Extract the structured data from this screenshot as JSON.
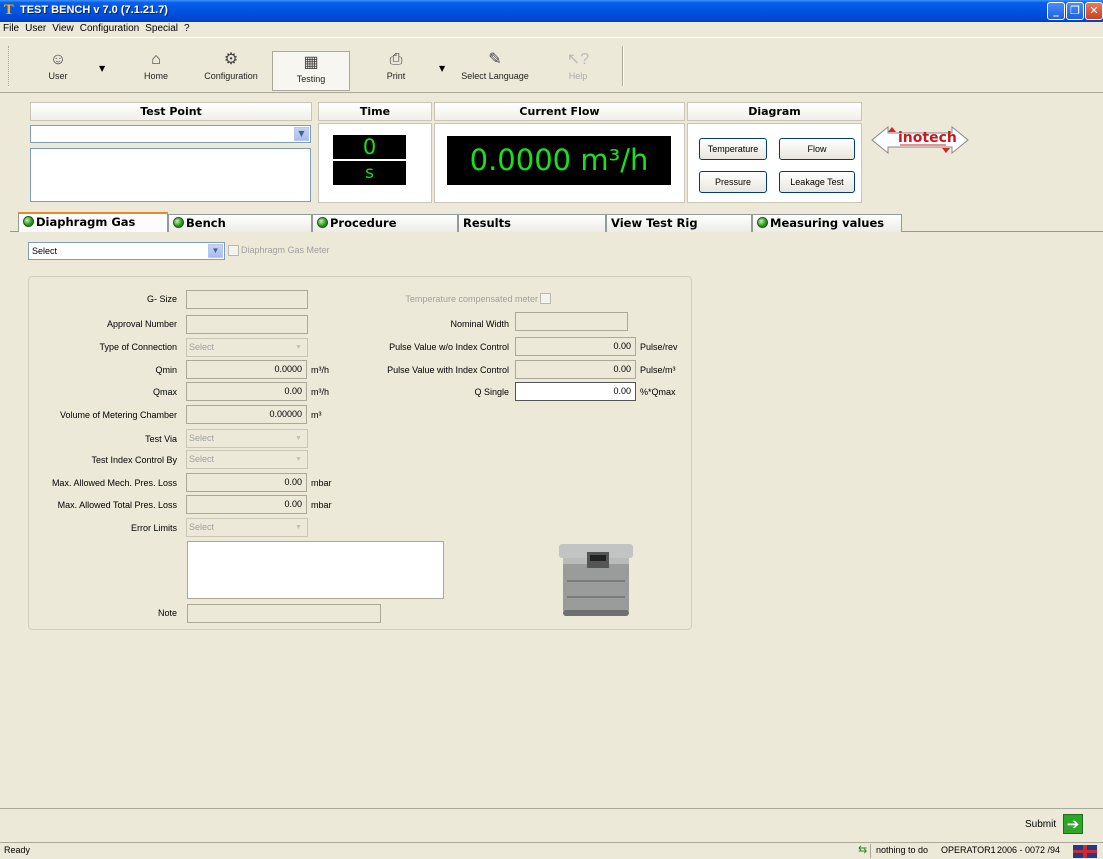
{
  "window": {
    "title": "TEST BENCH v 7.0 (7.1.21.7)",
    "app_icon_letter": "T"
  },
  "menu": [
    "File",
    "User",
    "View",
    "Configuration",
    "Special",
    "?"
  ],
  "toolbar": {
    "user": "User",
    "home": "Home",
    "configuration": "Configuration",
    "testing": "Testing",
    "print": "Print",
    "select_language": "Select Language",
    "help": "Help"
  },
  "panels": {
    "test_point": "Test Point",
    "time": "Time",
    "current_flow": "Current Flow",
    "diagram": "Diagram"
  },
  "time_display": {
    "value": "0",
    "unit": "s"
  },
  "flow_display": {
    "value": "0.0000 m³/h"
  },
  "diagram_buttons": {
    "temperature": "Temperature",
    "flow": "Flow",
    "pressure": "Pressure",
    "leakage": "Leakage Test"
  },
  "logo": "inotech",
  "tabs": [
    "Diaphragm Gas Meter",
    "Bench",
    "Procedure",
    "Results",
    "View Test Rig",
    "Measuring values"
  ],
  "meter_select": {
    "value": "Select",
    "checkbox_label": "Diaphragm Gas Meter"
  },
  "form": {
    "g_size": "G- Size",
    "approval_number": "Approval Number",
    "type_of_connection": "Type of Connection",
    "qmin": "Qmin",
    "qmax": "Qmax",
    "volume_chamber": "Volume of Metering Chamber",
    "test_via": "Test Via",
    "test_index_control_by": "Test Index Control By",
    "max_mech_loss": "Max. Allowed Mech. Pres. Loss",
    "max_total_loss": "Max. Allowed Total Pres. Loss",
    "error_limits": "Error Limits",
    "note": "Note",
    "select_placeholder": "Select",
    "qmin_value": "0.0000",
    "qmax_value": "0.00",
    "volume_value": "0.00000",
    "mech_loss_value": "0.00",
    "total_loss_value": "0.00",
    "unit_m3h": "m³/h",
    "unit_m3": "m³",
    "unit_mbar": "mbar",
    "temp_compensated": "Temperature compensated meter",
    "nominal_width": "Nominal Width",
    "pulse_wo_index": "Pulse Value w/o Index Control",
    "pulse_with_index": "Pulse Value with Index Control",
    "q_single": "Q Single",
    "pulse_wo_value": "0.00",
    "pulse_with_value": "0.00",
    "q_single_value": "0.00",
    "unit_pulse_rev": "Pulse/rev",
    "unit_pulse_m3": "Pulse/m³",
    "unit_qmax": "%*Qmax"
  },
  "submit": "Submit",
  "status": {
    "ready": "Ready",
    "message": "nothing to do",
    "operator": "OPERATOR1",
    "code": "2006 - 0072 /94"
  }
}
